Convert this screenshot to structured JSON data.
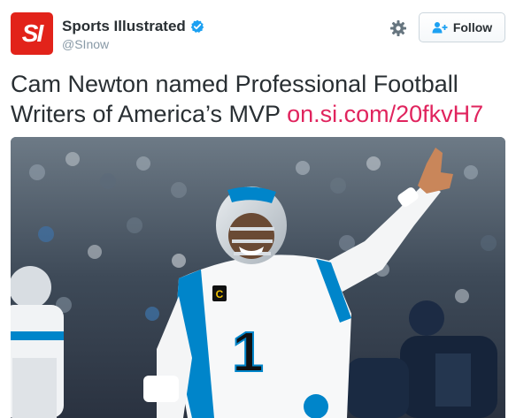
{
  "account": {
    "name": "Sports Illustrated",
    "handle": "@SInow",
    "avatar_text": "SI",
    "verified": true
  },
  "actions": {
    "follow_label": "Follow",
    "settings_icon": "gear-icon",
    "follow_icon": "add-user-icon"
  },
  "tweet": {
    "text": "Cam Newton named Professional Football Writers of America’s MVP",
    "link": "on.si.com/20fkvH7"
  },
  "photo": {
    "jersey_number": "1",
    "captain_letter": "C"
  },
  "colors": {
    "brand_red": "#e2231a",
    "link": "#e0245e",
    "verified_blue": "#1da1f2",
    "text": "#292f33",
    "muted": "#8899a6"
  }
}
